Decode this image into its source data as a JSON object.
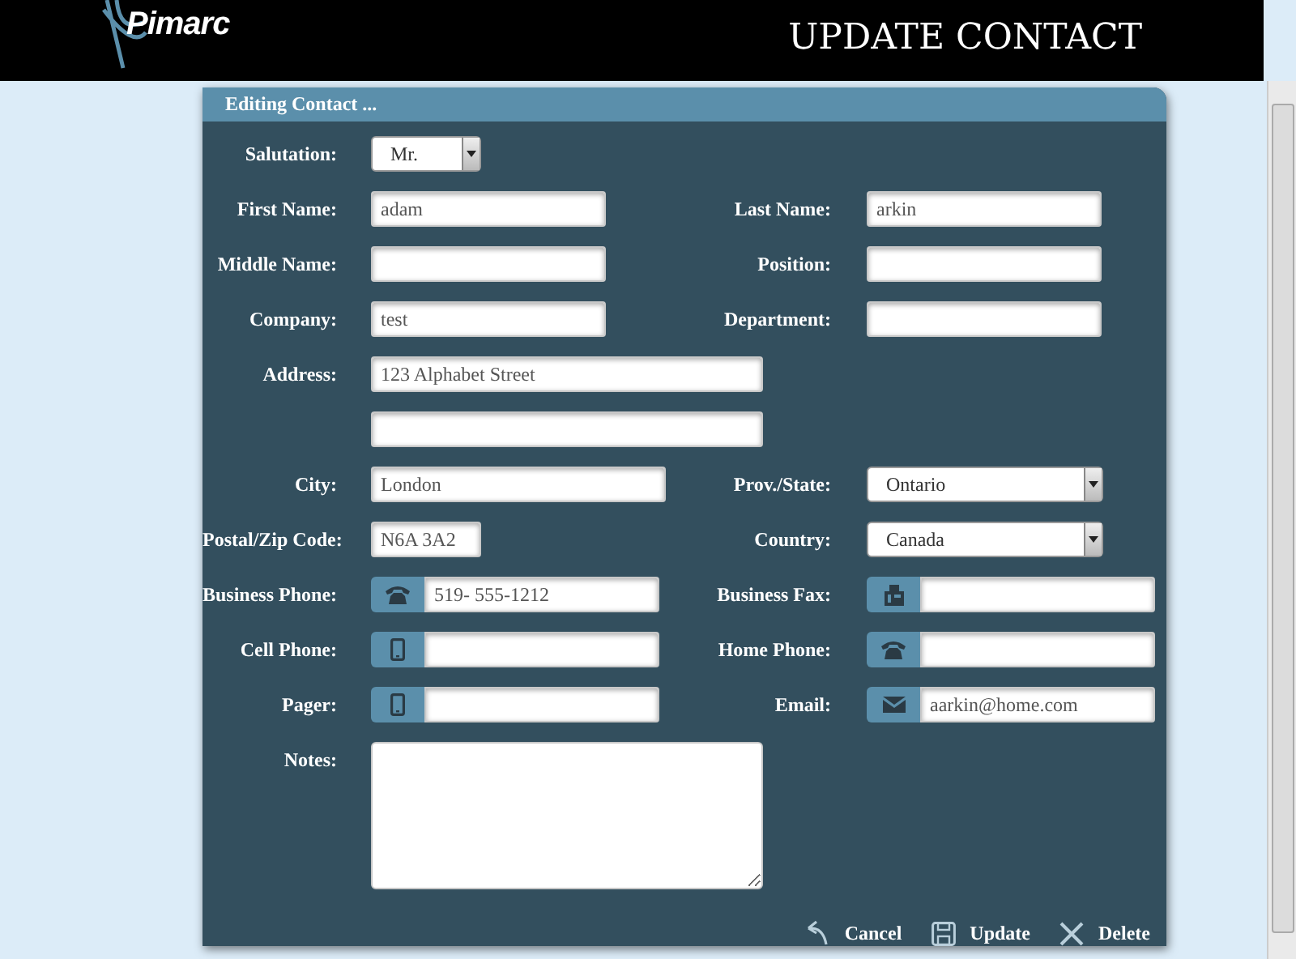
{
  "header": {
    "logo": "Pimarc",
    "title": "UPDATE CONTACT"
  },
  "panel": {
    "title": "Editing Contact ...",
    "rows": [
      {
        "left": {
          "label": "Salutation:",
          "kind": "select",
          "value": "Mr."
        }
      },
      {
        "left": {
          "label": "First Name:",
          "kind": "text",
          "value": "adam"
        },
        "right": {
          "label": "Last Name:",
          "kind": "text",
          "value": "arkin"
        }
      },
      {
        "left": {
          "label": "Middle Name:",
          "kind": "text"
        },
        "right": {
          "label": "Position:",
          "kind": "text"
        }
      },
      {
        "left": {
          "label": "Company:",
          "kind": "text",
          "value": "test"
        },
        "right": {
          "label": "Department:",
          "kind": "text"
        }
      },
      {
        "left": {
          "label": "Address:",
          "kind": "wide",
          "value": "123 Alphabet Street"
        }
      },
      {
        "left": {
          "kind": "wide"
        }
      },
      {
        "left": {
          "label": "City:",
          "kind": "text",
          "value": "London"
        },
        "right": {
          "label": "Prov./State:",
          "kind": "select",
          "value": "Ontario"
        }
      },
      {
        "left": {
          "label": "Postal/Zip Code:",
          "kind": "short",
          "value": "N6A 3A2"
        },
        "right": {
          "label": "Country:",
          "kind": "select",
          "value": "Canada"
        }
      },
      {
        "left": {
          "label": "Business Phone:",
          "kind": "phone",
          "value": "519- 555-1212"
        },
        "right": {
          "label": "Business Fax:",
          "kind": "fax"
        }
      },
      {
        "left": {
          "label": "Cell Phone:",
          "kind": "mobile"
        },
        "right": {
          "label": "Home Phone:",
          "kind": "phone"
        }
      },
      {
        "left": {
          "label": "Pager:",
          "kind": "mobile"
        },
        "right": {
          "label": "Email:",
          "kind": "email",
          "value": "aarkin@home.com"
        }
      },
      {
        "left": {
          "label": "Notes:",
          "kind": "notes"
        }
      }
    ],
    "buttons": [
      {
        "label": "Cancel",
        "kind": "cancel"
      },
      {
        "label": "Update",
        "kind": "update"
      },
      {
        "label": "Delete",
        "kind": "delete"
      }
    ]
  }
}
